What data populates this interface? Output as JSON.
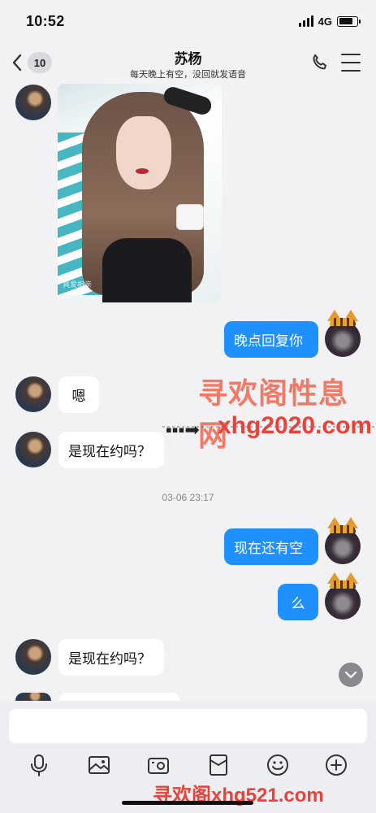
{
  "status_bar": {
    "time": "10:52",
    "network": "4G"
  },
  "header": {
    "unread_badge": "10",
    "title": "苏杨",
    "subtitle": "每天晚上有空，没回就发语音"
  },
  "messages": [
    {
      "side": "in",
      "type": "image",
      "photo_watermark": "真爱相亲"
    },
    {
      "side": "out",
      "type": "text",
      "text": "晚点回复你"
    },
    {
      "side": "in",
      "type": "text",
      "text": "嗯"
    },
    {
      "side": "in",
      "type": "text",
      "text": "是现在约吗？"
    },
    {
      "side": "system",
      "type": "timestamp",
      "text": "03-06 23:17"
    },
    {
      "side": "out",
      "type": "text",
      "text": "现在还有空"
    },
    {
      "side": "out",
      "type": "text",
      "text": "么"
    },
    {
      "side": "in",
      "type": "text",
      "text": "是现在约吗？"
    }
  ],
  "watermark": {
    "site_name": "寻欢阁性息网",
    "site_url": "xhg2020.com",
    "bottom": "寻欢阁xhg521.com"
  },
  "composer": {
    "input_value": "",
    "input_placeholder": ""
  },
  "toolbar": [
    "mic-icon",
    "image-icon",
    "camera-icon",
    "red-packet-icon",
    "emoji-icon",
    "plus-icon"
  ],
  "colors": {
    "bubble_out": "#1e90ff",
    "bubble_in": "#ffffff",
    "watermark": "#e8433a",
    "background": "#f2f2f5"
  }
}
